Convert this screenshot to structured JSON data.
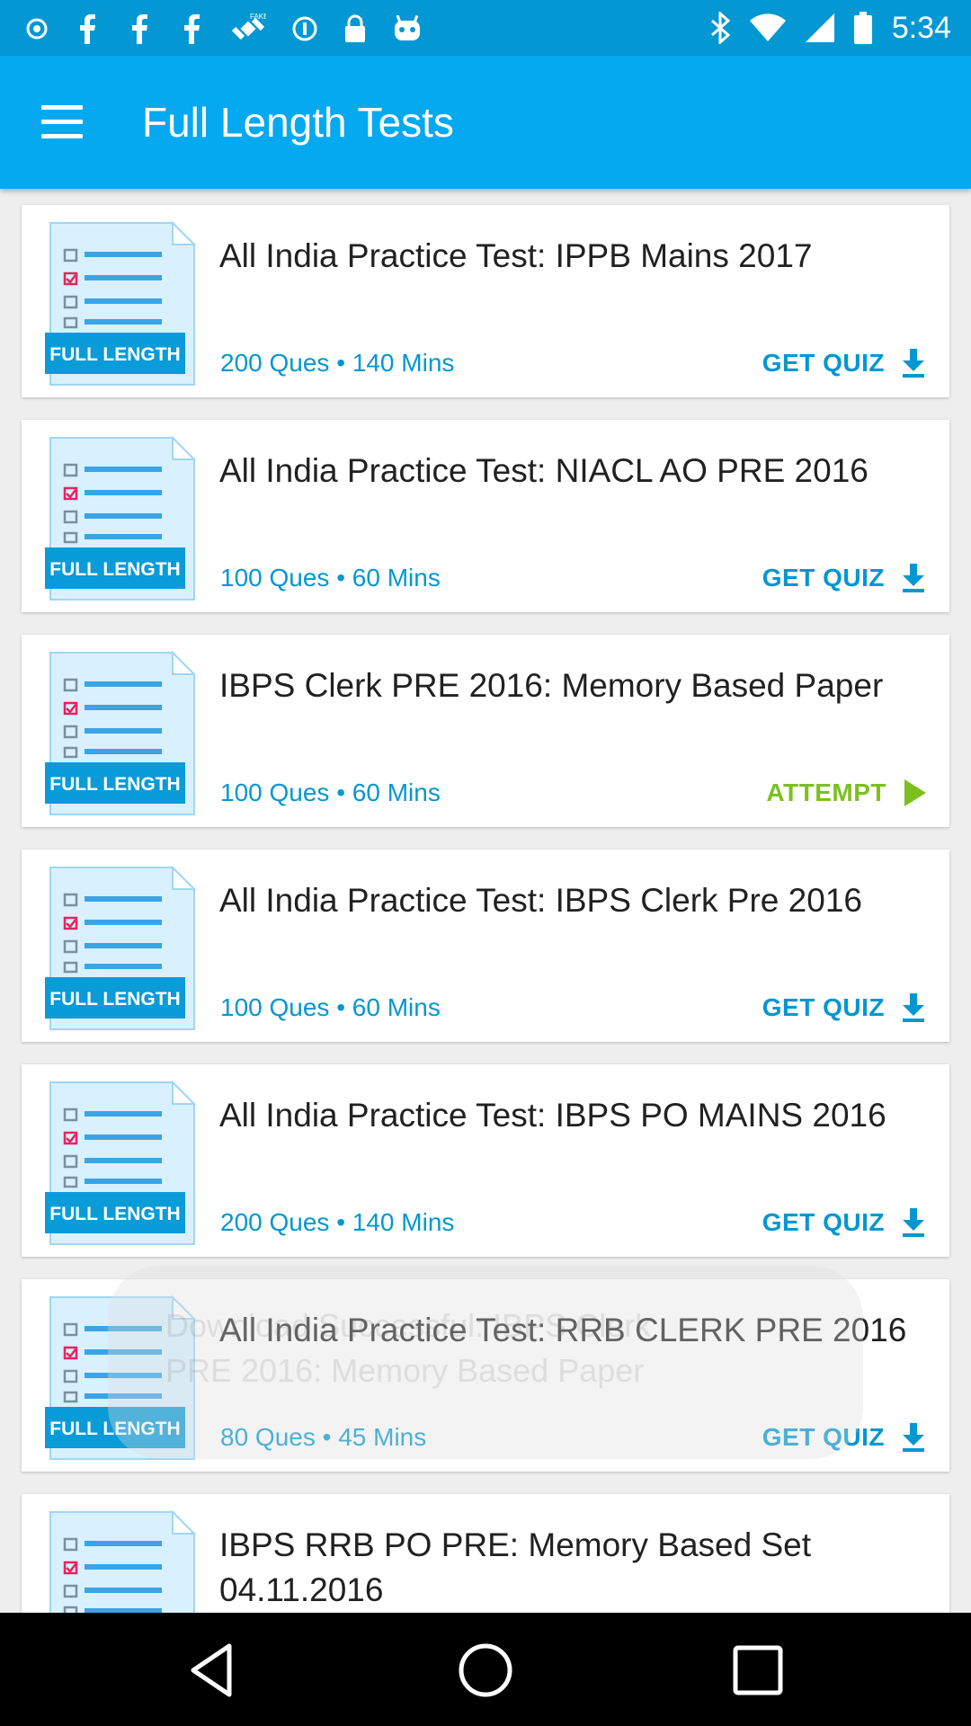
{
  "status_bar": {
    "time": "5:34",
    "left_icons": [
      "notification-icon",
      "facebook-icon",
      "facebook-icon",
      "facebook-icon",
      "fake-gps-icon",
      "sync-icon",
      "lock-icon",
      "android-icon"
    ],
    "right_icons": [
      "bluetooth-icon",
      "wifi-icon",
      "signal-icon",
      "battery-icon"
    ]
  },
  "app_bar": {
    "menu_icon": "hamburger-menu-icon",
    "title": "Full Length Tests"
  },
  "thumbnail": {
    "label": "FULL LENGTH",
    "icon": "document-checklist-icon"
  },
  "tests": [
    {
      "title": "All India Practice Test: IPPB Mains 2017",
      "meta": "200 Ques • 140 Mins",
      "action": "GET QUIZ",
      "action_type": "download"
    },
    {
      "title": "All India Practice Test: NIACL AO PRE 2016",
      "meta": "100 Ques • 60 Mins",
      "action": "GET QUIZ",
      "action_type": "download"
    },
    {
      "title": "IBPS Clerk PRE 2016: Memory Based Paper",
      "meta": "100 Ques • 60 Mins",
      "action": "ATTEMPT",
      "action_type": "attempt"
    },
    {
      "title": "All India Practice Test: IBPS Clerk Pre 2016",
      "meta": "100 Ques • 60 Mins",
      "action": "GET QUIZ",
      "action_type": "download"
    },
    {
      "title": "All India Practice Test: IBPS PO MAINS 2016",
      "meta": "200 Ques • 140 Mins",
      "action": "GET QUIZ",
      "action_type": "download"
    },
    {
      "title": "All India Practice Test: RRB CLERK PRE 2016",
      "meta": "80 Ques • 45 Mins",
      "action": "GET QUIZ",
      "action_type": "download"
    },
    {
      "title": "IBPS RRB PO PRE: Memory Based Set 04.11.2016",
      "meta": "",
      "action": "",
      "action_type": ""
    }
  ],
  "toast": {
    "text": "Download Successful: IBPS Clerk PRE 2016: Memory Based Paper"
  },
  "nav_bar": {
    "back_icon": "back-triangle-icon",
    "home_icon": "home-circle-icon",
    "recents_icon": "recents-square-icon"
  },
  "colors": {
    "status_bar": "#0398d4",
    "app_bar": "#04a9f0",
    "accent_blue": "#0397d2",
    "attempt_green": "#7cc01f",
    "thumb_checkbox_red": "#e8245c"
  }
}
